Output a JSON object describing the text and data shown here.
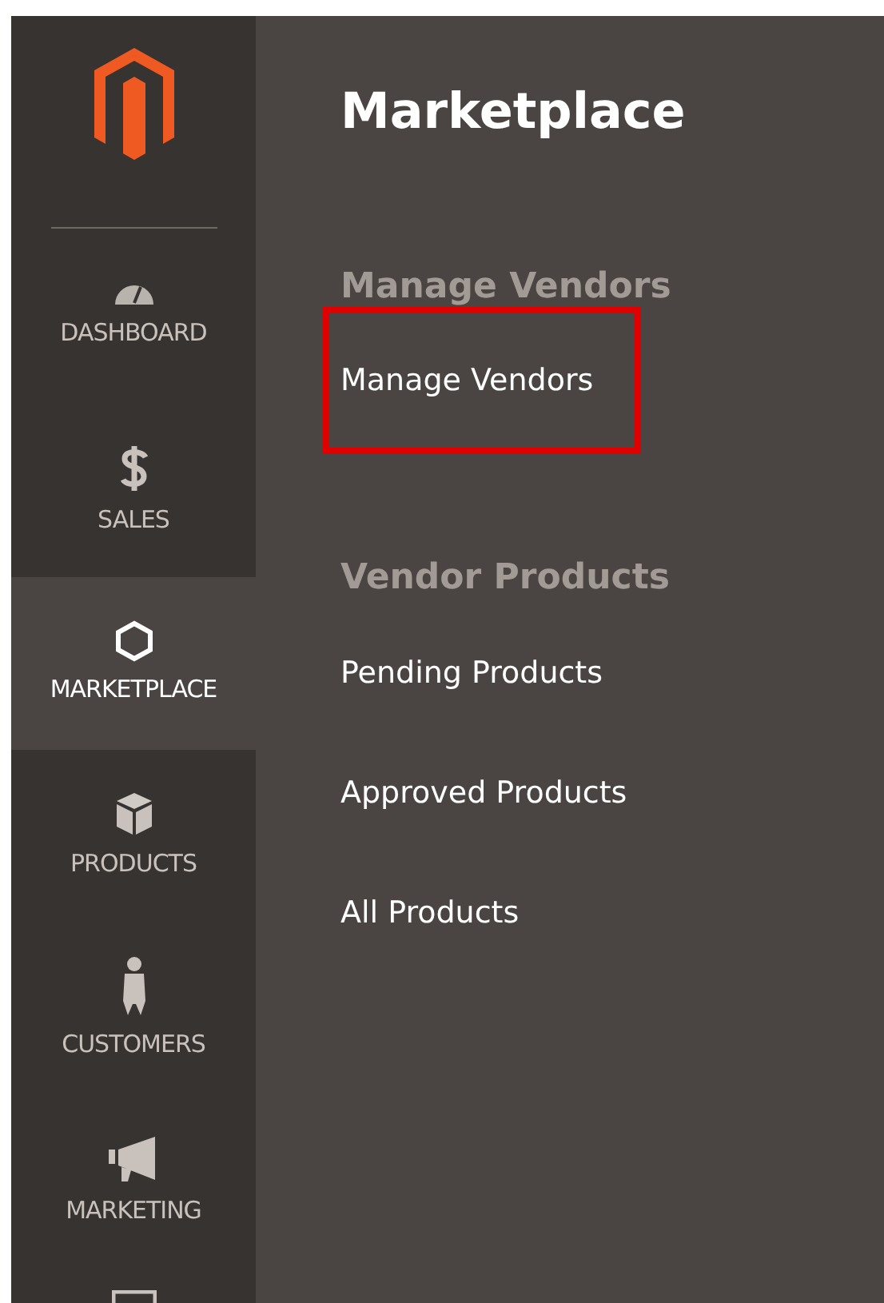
{
  "sidebar": {
    "items": [
      {
        "kind": "dashboard",
        "label": "DASHBOARD",
        "selected": false
      },
      {
        "kind": "sales",
        "label": "SALES",
        "selected": false
      },
      {
        "kind": "marketplace",
        "label": "MARKETPLACE",
        "selected": true
      },
      {
        "kind": "products",
        "label": "PRODUCTS",
        "selected": false
      },
      {
        "kind": "customers",
        "label": "CUSTOMERS",
        "selected": false
      },
      {
        "kind": "marketing",
        "label": "MARKETING",
        "selected": false
      }
    ]
  },
  "menu": {
    "title": "Marketplace",
    "sections": [
      {
        "heading": "Manage Vendors",
        "links": [
          {
            "label": "Manage Vendors",
            "highlighted": true
          }
        ]
      },
      {
        "heading": "Vendor Products",
        "links": [
          {
            "label": "Pending Products",
            "highlighted": false
          },
          {
            "label": "Approved Products",
            "highlighted": false
          },
          {
            "label": "All Products",
            "highlighted": false
          }
        ]
      }
    ]
  }
}
